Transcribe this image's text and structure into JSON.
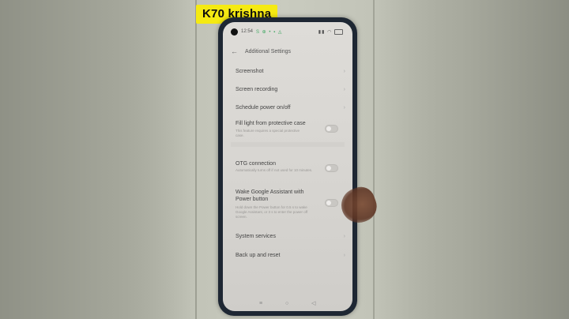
{
  "caption": "K70 krishna",
  "status": {
    "time": "12:54",
    "icons": "S ⊕ • ▪ ◬"
  },
  "header": {
    "title": "Additional Settings",
    "back_icon": "back-arrow-icon"
  },
  "settings": {
    "screenshot": "Screenshot",
    "screen_recording": "Screen recording",
    "schedule_power": "Schedule power on/off",
    "fill_light": {
      "label": "Fill light from protective case",
      "sub": "This feature requires a special protective case."
    },
    "otg": {
      "label": "OTG connection",
      "sub": "Automatically turns off if not used for 10 minutes."
    },
    "wake_assistant": {
      "label_line1": "Wake Google Assistant with",
      "label_line2": "Power button",
      "sub": "Hold down the Power button for 0.5 s to wake Google Assistant, or 3 s to enter the power off screen."
    },
    "system_services": "System services",
    "backup_reset": "Back up and reset"
  }
}
